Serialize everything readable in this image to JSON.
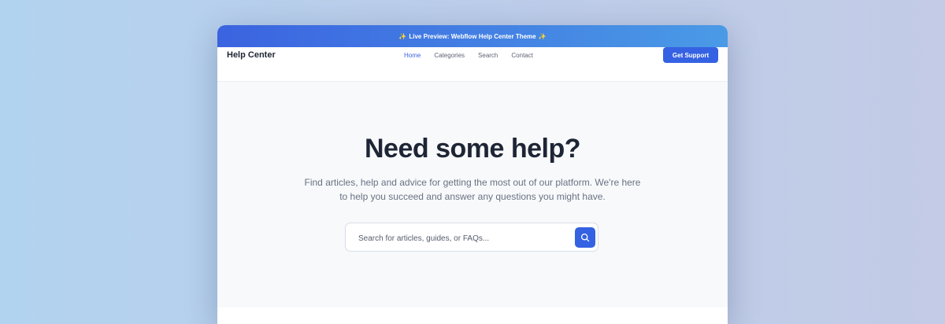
{
  "banner": {
    "text": "Live Preview: Webflow Help Center Theme",
    "icon": "sparkles-icon"
  },
  "nav": {
    "brand": "Help Center",
    "links": [
      {
        "label": "Home",
        "active": true
      },
      {
        "label": "Categories",
        "active": false
      },
      {
        "label": "Search",
        "active": false
      },
      {
        "label": "Contact",
        "active": false
      }
    ],
    "cta_label": "Get Support"
  },
  "hero": {
    "title": "Need some help?",
    "subtitle": "Find articles, help and advice for getting the most out of our platform. We're here to help you succeed and answer any questions you might have."
  },
  "search": {
    "value": "",
    "placeholder": "Search for articles, guides, or FAQs...",
    "button_icon": "search-icon"
  },
  "colors": {
    "accent": "#3562e2",
    "banner_gradient_start": "#3b63e0",
    "banner_gradient_end": "#4a9ae6",
    "heading": "#1e2535",
    "body_text": "#6a7282"
  }
}
